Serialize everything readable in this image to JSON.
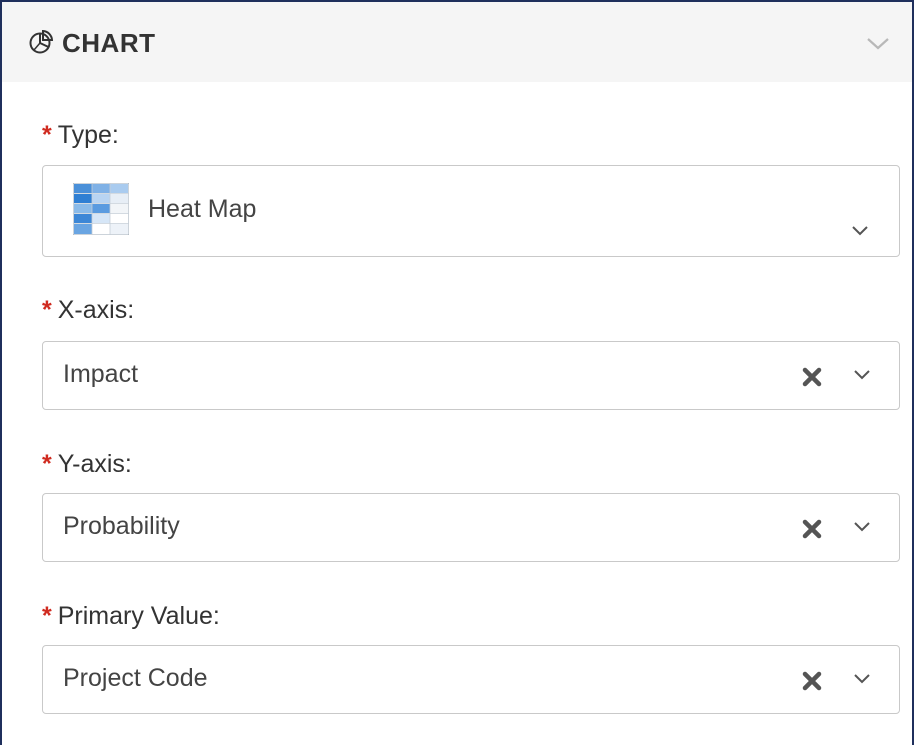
{
  "header": {
    "title": "CHART",
    "icon": "pie-chart-icon",
    "collapse_icon": "chevron-down-icon"
  },
  "fields": {
    "type": {
      "required_mark": "*",
      "label": "Type:",
      "value": "Heat Map",
      "icon": "heat-map-icon"
    },
    "x_axis": {
      "required_mark": "*",
      "label": "X-axis:",
      "value": "Impact"
    },
    "y_axis": {
      "required_mark": "*",
      "label": "Y-axis:",
      "value": "Probability"
    },
    "primary_value": {
      "required_mark": "*",
      "label": "Primary Value:",
      "value": "Project Code"
    }
  },
  "colors": {
    "required": "#d02b20",
    "border": "#c9c9c9",
    "header_bg": "#f5f5f5",
    "frame": "#1f2f5c"
  }
}
